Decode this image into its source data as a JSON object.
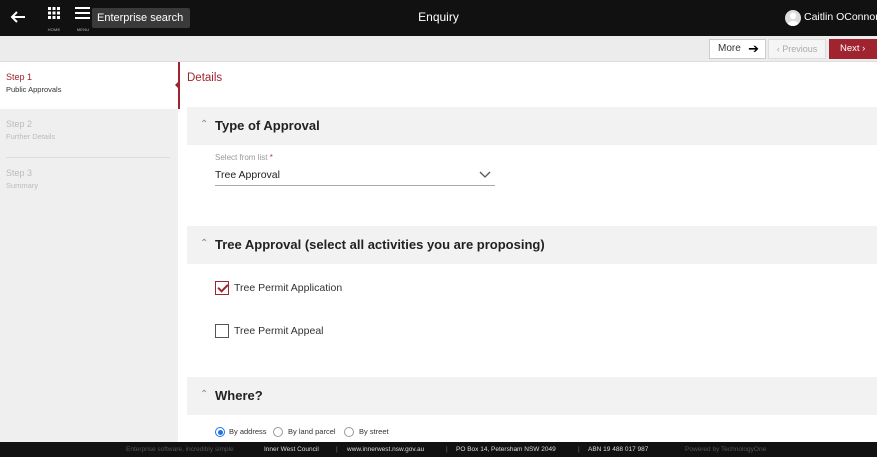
{
  "topbar": {
    "home_label": "HOME",
    "menu_label": "MENU",
    "search_label": "Enterprise search",
    "title": "Enquiry",
    "user_name": "Caitlin OConnor"
  },
  "actions": {
    "more_label": "More",
    "previous_label": "‹ Previous",
    "next_label": "Next ›"
  },
  "steps": [
    {
      "title": "Step 1",
      "subtitle": "Public Approvals",
      "active": true
    },
    {
      "title": "Step 2",
      "subtitle": "Further Details",
      "active": false
    },
    {
      "title": "Step 3",
      "subtitle": "Summary",
      "active": false
    }
  ],
  "main": {
    "details_title": "Details",
    "type_section": {
      "title": "Type of Approval",
      "field_label": "Select from list",
      "required_mark": "*",
      "selected_value": "Tree Approval"
    },
    "tree_section": {
      "title": "Tree Approval (select all activities you are proposing)",
      "options": [
        {
          "label": "Tree Permit Application",
          "checked": true
        },
        {
          "label": "Tree Permit Appeal",
          "checked": false
        }
      ]
    },
    "where_section": {
      "title": "Where?",
      "options": [
        {
          "label": "By address",
          "selected": true
        },
        {
          "label": "By land parcel",
          "selected": false
        },
        {
          "label": "By street",
          "selected": false
        }
      ]
    }
  },
  "footer": {
    "tagline": "Enterprise software, incredibly simple",
    "council": "Inner West Council",
    "website": "www.innerwest.nsw.gov.au",
    "address": "PO Box 14, Petersham NSW 2049",
    "abn": "ABN 19 488 017 987",
    "powered": "Powered by TechnologyOne",
    "separator": "|"
  },
  "colors": {
    "accent": "#a0242f",
    "topbar": "#111111",
    "radio": "#1e73e8"
  }
}
